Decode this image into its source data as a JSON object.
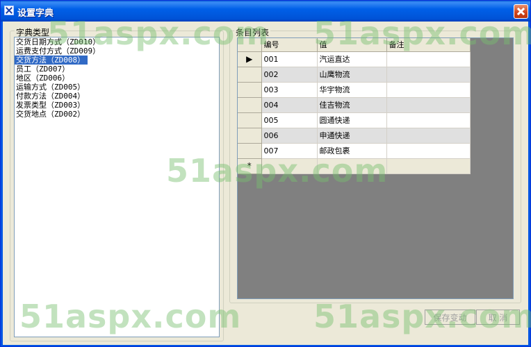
{
  "window": {
    "title": "设置字典"
  },
  "dict_group": {
    "title": "字典类型",
    "items": [
      "交货日期方式（ZD010）",
      "运费支付方式（ZD009）",
      "交货方法（ZD008）",
      "员工（ZD007）",
      "地区（ZD006）",
      "运输方式（ZD005）",
      "付款方法（ZD004）",
      "发票类型（ZD003）",
      "交货地点（ZD002）"
    ],
    "selected_index": 2
  },
  "items_group": {
    "title": "条目列表",
    "columns": [
      "编号",
      "值",
      "备注"
    ],
    "rows": [
      [
        "001",
        "汽运直达",
        ""
      ],
      [
        "002",
        "山鹰物流",
        ""
      ],
      [
        "003",
        "华宇物流",
        ""
      ],
      [
        "004",
        "佳吉物流",
        ""
      ],
      [
        "005",
        "圆通快递",
        ""
      ],
      [
        "006",
        "申通快递",
        ""
      ],
      [
        "007",
        "邮政包裹",
        ""
      ]
    ],
    "current_row_marker": "▶",
    "new_row_marker": "*"
  },
  "buttons": {
    "save": "保存变动",
    "cancel": "取  消"
  },
  "watermark": "51aspx.com"
}
